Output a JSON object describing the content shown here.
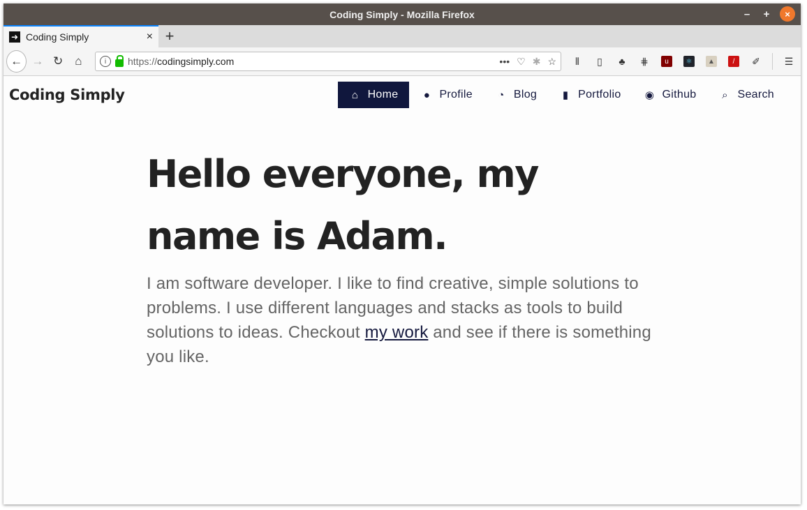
{
  "window": {
    "title": "Coding Simply - Mozilla Firefox",
    "controls": {
      "minimize": "–",
      "maximize": "+",
      "close": "×"
    }
  },
  "tabs": [
    {
      "title": "Coding Simply",
      "close": "×"
    }
  ],
  "new_tab": "+",
  "urlbar": {
    "protocol": "https://",
    "host": "codingsimply.com",
    "more": "•••"
  },
  "site": {
    "brand": "Coding Simply",
    "nav": [
      {
        "label": "Home",
        "icon": "home-icon",
        "glyph": "⌂",
        "active": true
      },
      {
        "label": "Profile",
        "icon": "user-icon",
        "glyph": "👤",
        "active": false
      },
      {
        "label": "Blog",
        "icon": "rss-icon",
        "glyph": "⦾",
        "active": false
      },
      {
        "label": "Portfolio",
        "icon": "bookmark-icon",
        "glyph": "🔖",
        "active": false
      },
      {
        "label": "Github",
        "icon": "github-icon",
        "glyph": "◉",
        "active": false
      },
      {
        "label": "Search",
        "icon": "search-icon",
        "glyph": "🔍",
        "active": false
      }
    ]
  },
  "hero": {
    "heading": "Hello everyone, my name is Adam.",
    "text_before": "I am software developer. I like to find creative, simple solutions to problems. I use different languages and stacks as tools to build solutions to ideas. Checkout ",
    "link_text": "my work",
    "text_after": " and see if there is something you like."
  },
  "colors": {
    "titlebar": "#57504b",
    "nav_active_bg": "#10173d",
    "nav_text": "#14183d",
    "close_button": "#f0782c",
    "heading": "#222222",
    "body_text": "#646464"
  }
}
